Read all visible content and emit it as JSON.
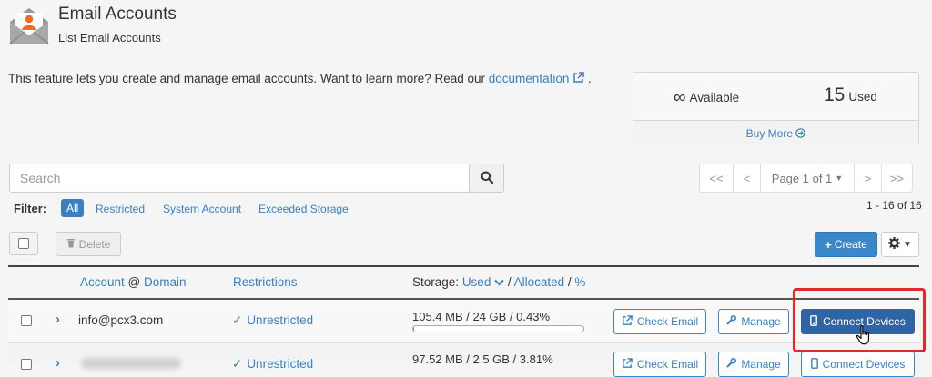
{
  "header": {
    "title": "Email Accounts",
    "subtitle": "List Email Accounts",
    "icon": "email-accounts-icon"
  },
  "intro": {
    "text": "This feature lets you create and manage email accounts. Want to learn more? Read our ",
    "link": "documentation",
    "suffix": "."
  },
  "stats": {
    "available_symbol": "∞",
    "available_label": "Available",
    "used_count": "15",
    "used_label": "Used",
    "buy_more": "Buy More"
  },
  "search": {
    "placeholder": "Search"
  },
  "pagination": {
    "first": "<<",
    "prev": "<",
    "page": "Page 1 of 1",
    "next": ">",
    "last": ">>",
    "range": "1 - 16 of 16"
  },
  "filter": {
    "label": "Filter:",
    "options": [
      "All",
      "Restricted",
      "System Account",
      "Exceeded Storage"
    ],
    "selected": "All"
  },
  "toolbar": {
    "delete": "Delete",
    "create": "Create"
  },
  "table": {
    "col_account": "Account",
    "col_at": "@",
    "col_domain": "Domain",
    "col_restrictions": "Restrictions",
    "col_storage": "Storage:",
    "col_used": "Used",
    "col_allocated": "Allocated",
    "col_percent": "%",
    "rows": [
      {
        "account": "info@pcx3.com",
        "restriction": "Unrestricted",
        "storage": "105.4 MB / 24 GB / 0.43%",
        "percent": 0.43,
        "check_email": "Check Email",
        "manage": "Manage",
        "connect": "Connect Devices"
      },
      {
        "account": "",
        "restriction": "Unrestricted",
        "storage": "97.52 MB / 2.5 GB / 3.81%",
        "percent": 3.81,
        "check_email": "Check Email",
        "manage": "Manage",
        "connect": "Connect Devices"
      }
    ]
  },
  "colors": {
    "accent": "#3a7fbf",
    "primary_button": "#3a87c9",
    "connect_button": "#2f65a6",
    "highlight": "#e0292a",
    "success": "#3c8d3c"
  }
}
